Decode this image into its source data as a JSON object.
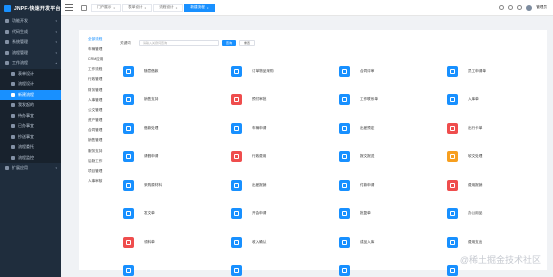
{
  "app": {
    "title": "JNPF-快速开发平台"
  },
  "sidebar": {
    "items": [
      {
        "label": "功能开发",
        "icon": "home-icon",
        "caret": "▾"
      },
      {
        "label": "代码生成",
        "icon": "code-icon",
        "caret": "▾"
      },
      {
        "label": "系统管理",
        "icon": "gear-icon",
        "caret": "▾"
      },
      {
        "label": "流程管理",
        "icon": "flow-icon",
        "caret": "▾"
      },
      {
        "label": "工作流程",
        "icon": "workflow-icon",
        "caret": "▴"
      },
      {
        "label": "表单设计",
        "icon": "form-icon",
        "sub": true
      },
      {
        "label": "流程设计",
        "icon": "design-icon",
        "sub": true
      },
      {
        "label": "新建流程",
        "icon": "new-icon",
        "sub": true,
        "active": true
      },
      {
        "label": "我发起的",
        "icon": "send-icon",
        "sub": true
      },
      {
        "label": "待办事宜",
        "icon": "todo-icon",
        "sub": true
      },
      {
        "label": "已办事宜",
        "icon": "done-icon",
        "sub": true
      },
      {
        "label": "抄送事宜",
        "icon": "cc-icon",
        "sub": true
      },
      {
        "label": "流程委托",
        "icon": "delegate-icon",
        "sub": true
      },
      {
        "label": "流程监控",
        "icon": "monitor-icon",
        "sub": true
      },
      {
        "label": "扩展应用",
        "icon": "ext-icon",
        "caret": "▾"
      }
    ]
  },
  "topbar": {
    "tabs": [
      {
        "label": "门户展示",
        "closable": true
      },
      {
        "label": "表单设计",
        "closable": true
      },
      {
        "label": "流程设计",
        "closable": true
      },
      {
        "label": "新建流程",
        "closable": true,
        "active": true
      }
    ],
    "close_glyph": "×",
    "user_name": "管理员"
  },
  "categories": [
    "全部流程",
    "车辆管理",
    "CRM应用",
    "工作流程",
    "行政管理",
    "财务管理",
    "人事管理",
    "公文管理",
    "资产管理",
    "合同管理",
    "销售管理",
    "服务支持",
    "后勤工作",
    "项目管理",
    "人事审核"
  ],
  "search": {
    "label": "关键词",
    "placeholder": "请输入关键词查询",
    "search_button": "查询",
    "reset_button": "重置"
  },
  "flows": [
    {
      "label": "随意借款",
      "color": "#1890ff"
    },
    {
      "label": "订单物品采购",
      "color": "#1890ff"
    },
    {
      "label": "合同评审",
      "color": "#1890ff"
    },
    {
      "label": "员工申请单",
      "color": "#1890ff"
    },
    {
      "label": "销售支持",
      "color": "#1890ff"
    },
    {
      "label": "预付审批",
      "color": "#ef4d4d"
    },
    {
      "label": "工作联系单",
      "color": "#1890ff"
    },
    {
      "label": "入库单",
      "color": "#1890ff"
    },
    {
      "label": "借款处理",
      "color": "#1890ff"
    },
    {
      "label": "车辆申请",
      "color": "#1890ff"
    },
    {
      "label": "出差预定",
      "color": "#1890ff"
    },
    {
      "label": "出行卡单",
      "color": "#ef4d4d"
    },
    {
      "label": "请假申请",
      "color": "#1890ff"
    },
    {
      "label": "行政费用",
      "color": "#ef4d4d"
    },
    {
      "label": "报文报送",
      "color": "#1890ff"
    },
    {
      "label": "软文处理",
      "color": "#f79f1f"
    },
    {
      "label": "采购原材料",
      "color": "#1890ff"
    },
    {
      "label": "出差报销",
      "color": "#1890ff"
    },
    {
      "label": "付款申请",
      "color": "#1890ff"
    },
    {
      "label": "费用报销",
      "color": "#ef4d4d"
    },
    {
      "label": "发文单",
      "color": "#1890ff"
    },
    {
      "label": "开会申请",
      "color": "#1890ff"
    },
    {
      "label": "批复单",
      "color": "#1890ff"
    },
    {
      "label": "办公用品",
      "color": "#1890ff"
    },
    {
      "label": "领料单",
      "color": "#ef4d4d"
    },
    {
      "label": "收入确认",
      "color": "#1890ff"
    },
    {
      "label": "成品入库",
      "color": "#1890ff"
    },
    {
      "label": "费用支出",
      "color": "#1890ff"
    },
    {
      "label": "",
      "color": "#1890ff"
    },
    {
      "label": "",
      "color": "#1890ff"
    },
    {
      "label": "",
      "color": "#1890ff"
    },
    {
      "label": "",
      "color": "#1890ff"
    }
  ],
  "watermark": "@稀土掘金技术社区"
}
